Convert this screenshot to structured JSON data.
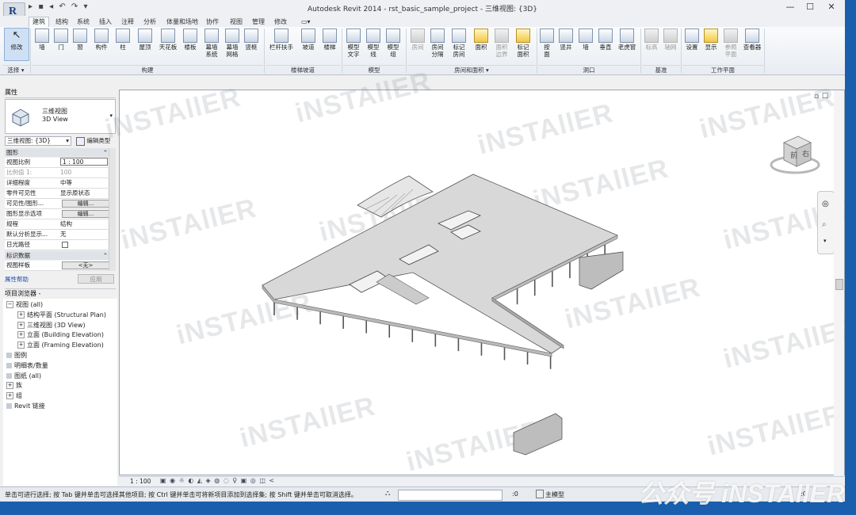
{
  "window": {
    "title": "Autodesk Revit 2014 -      rst_basic_sample_project - 三维视图: {3D}",
    "minimize": "—",
    "maximize": "☐",
    "close": "✕"
  },
  "qat_symbols": "▸ ▪ ◂ ↶ ↷ ▾",
  "tabs": [
    "建筑",
    "结构",
    "系统",
    "插入",
    "注释",
    "分析",
    "体量和场地",
    "协作",
    "视图",
    "管理",
    "修改",
    "▭▾"
  ],
  "ribbon": {
    "modify": "修改",
    "select_menu": "选择 ▾",
    "build": [
      "墙",
      "门",
      "窗",
      "构件",
      "柱",
      "屋顶",
      "天花板",
      "楼板",
      "幕墙\n系统",
      "幕墙\n网格",
      "竖梃"
    ],
    "circulation": [
      "栏杆扶手",
      "坡道",
      "楼梯"
    ],
    "model": [
      "模型\n文字",
      "模型\n线",
      "模型\n组"
    ],
    "room_area": [
      "房间",
      "房间\n分隔",
      "标记\n房间",
      "面积",
      "面积\n边界",
      "标记\n面积"
    ],
    "opening": [
      "按\n面",
      "竖井",
      "墙",
      "垂直",
      "老虎窗"
    ],
    "datum": [
      "标高",
      "轴网"
    ],
    "workplane": [
      "设置",
      "显示",
      "参照\n平面",
      "查看器"
    ],
    "panels": {
      "build": "构建",
      "circulation": "楼梯坡道",
      "model": "模型",
      "room_area": "房间和面积 ▾",
      "opening": "洞口",
      "datum": "基准",
      "workplane": "工作平面"
    }
  },
  "properties": {
    "header": "属性",
    "type_name_cn": "三维视图",
    "type_name_en": "3D View",
    "selector": "三维视图: {3D}",
    "edit_type": "编辑类型",
    "section_graphics": "图形",
    "rows": [
      {
        "k": "视图比例",
        "v": "1 : 100"
      },
      {
        "k": "比例值 1:",
        "v": "100"
      },
      {
        "k": "详细程度",
        "v": "中等"
      },
      {
        "k": "零件可见性",
        "v": "显示原状态"
      },
      {
        "k": "可见性/图形...",
        "v": "编辑..."
      },
      {
        "k": "图形显示选项",
        "v": "编辑..."
      },
      {
        "k": "规程",
        "v": "结构"
      },
      {
        "k": "默认分析显示...",
        "v": "无"
      },
      {
        "k": "日光路径",
        "v": ""
      }
    ],
    "section_identity": "标识数据",
    "template_row": {
      "k": "视图样板",
      "v": "<无>"
    },
    "help": "属性帮助",
    "apply": "应用",
    "collapse": "⌃"
  },
  "browser": {
    "header": "项目浏览器 - rst_basic_sample_proj...",
    "items": [
      {
        "label": "视图 (all)",
        "indent": 0,
        "ex": "−"
      },
      {
        "label": "结构平面 (Structural Plan)",
        "indent": 1,
        "ex": "+"
      },
      {
        "label": "三维视图 (3D View)",
        "indent": 1,
        "ex": "+"
      },
      {
        "label": "立面 (Building Elevation)",
        "indent": 1,
        "ex": "+"
      },
      {
        "label": "立面 (Framing Elevation)",
        "indent": 1,
        "ex": "+"
      },
      {
        "label": "图例",
        "indent": 0,
        "ex": ""
      },
      {
        "label": "明细表/数量",
        "indent": 0,
        "ex": ""
      },
      {
        "label": "图纸 (all)",
        "indent": 0,
        "ex": ""
      },
      {
        "label": "族",
        "indent": 0,
        "ex": "+"
      },
      {
        "label": "组",
        "indent": 0,
        "ex": "+"
      },
      {
        "label": "Revit 链接",
        "indent": 0,
        "ex": ""
      }
    ]
  },
  "viewcube": {
    "front": "前",
    "right": "右"
  },
  "viewbar": {
    "scale": "1 : 100",
    "icons": "▣ ◉ ☼ ◐ ◭ ◈ ◍ ◌ ♀ ▣ ◎ ◫ <"
  },
  "statusbar": {
    "hint": "单击可进行选择; 按 Tab 键并单击可选择其他项目; 按 Ctrl 键并单击可将新项目添加到选择集; 按 Shift 键并单击可取消选择。",
    "zero": ":0",
    "main_model": "主模型"
  },
  "watermark": "iNSTAllER",
  "corner_watermark": "公众号 iNSTAllER",
  "colors": {
    "accent": "#1a5fae",
    "slab": "#d7d7d7"
  }
}
